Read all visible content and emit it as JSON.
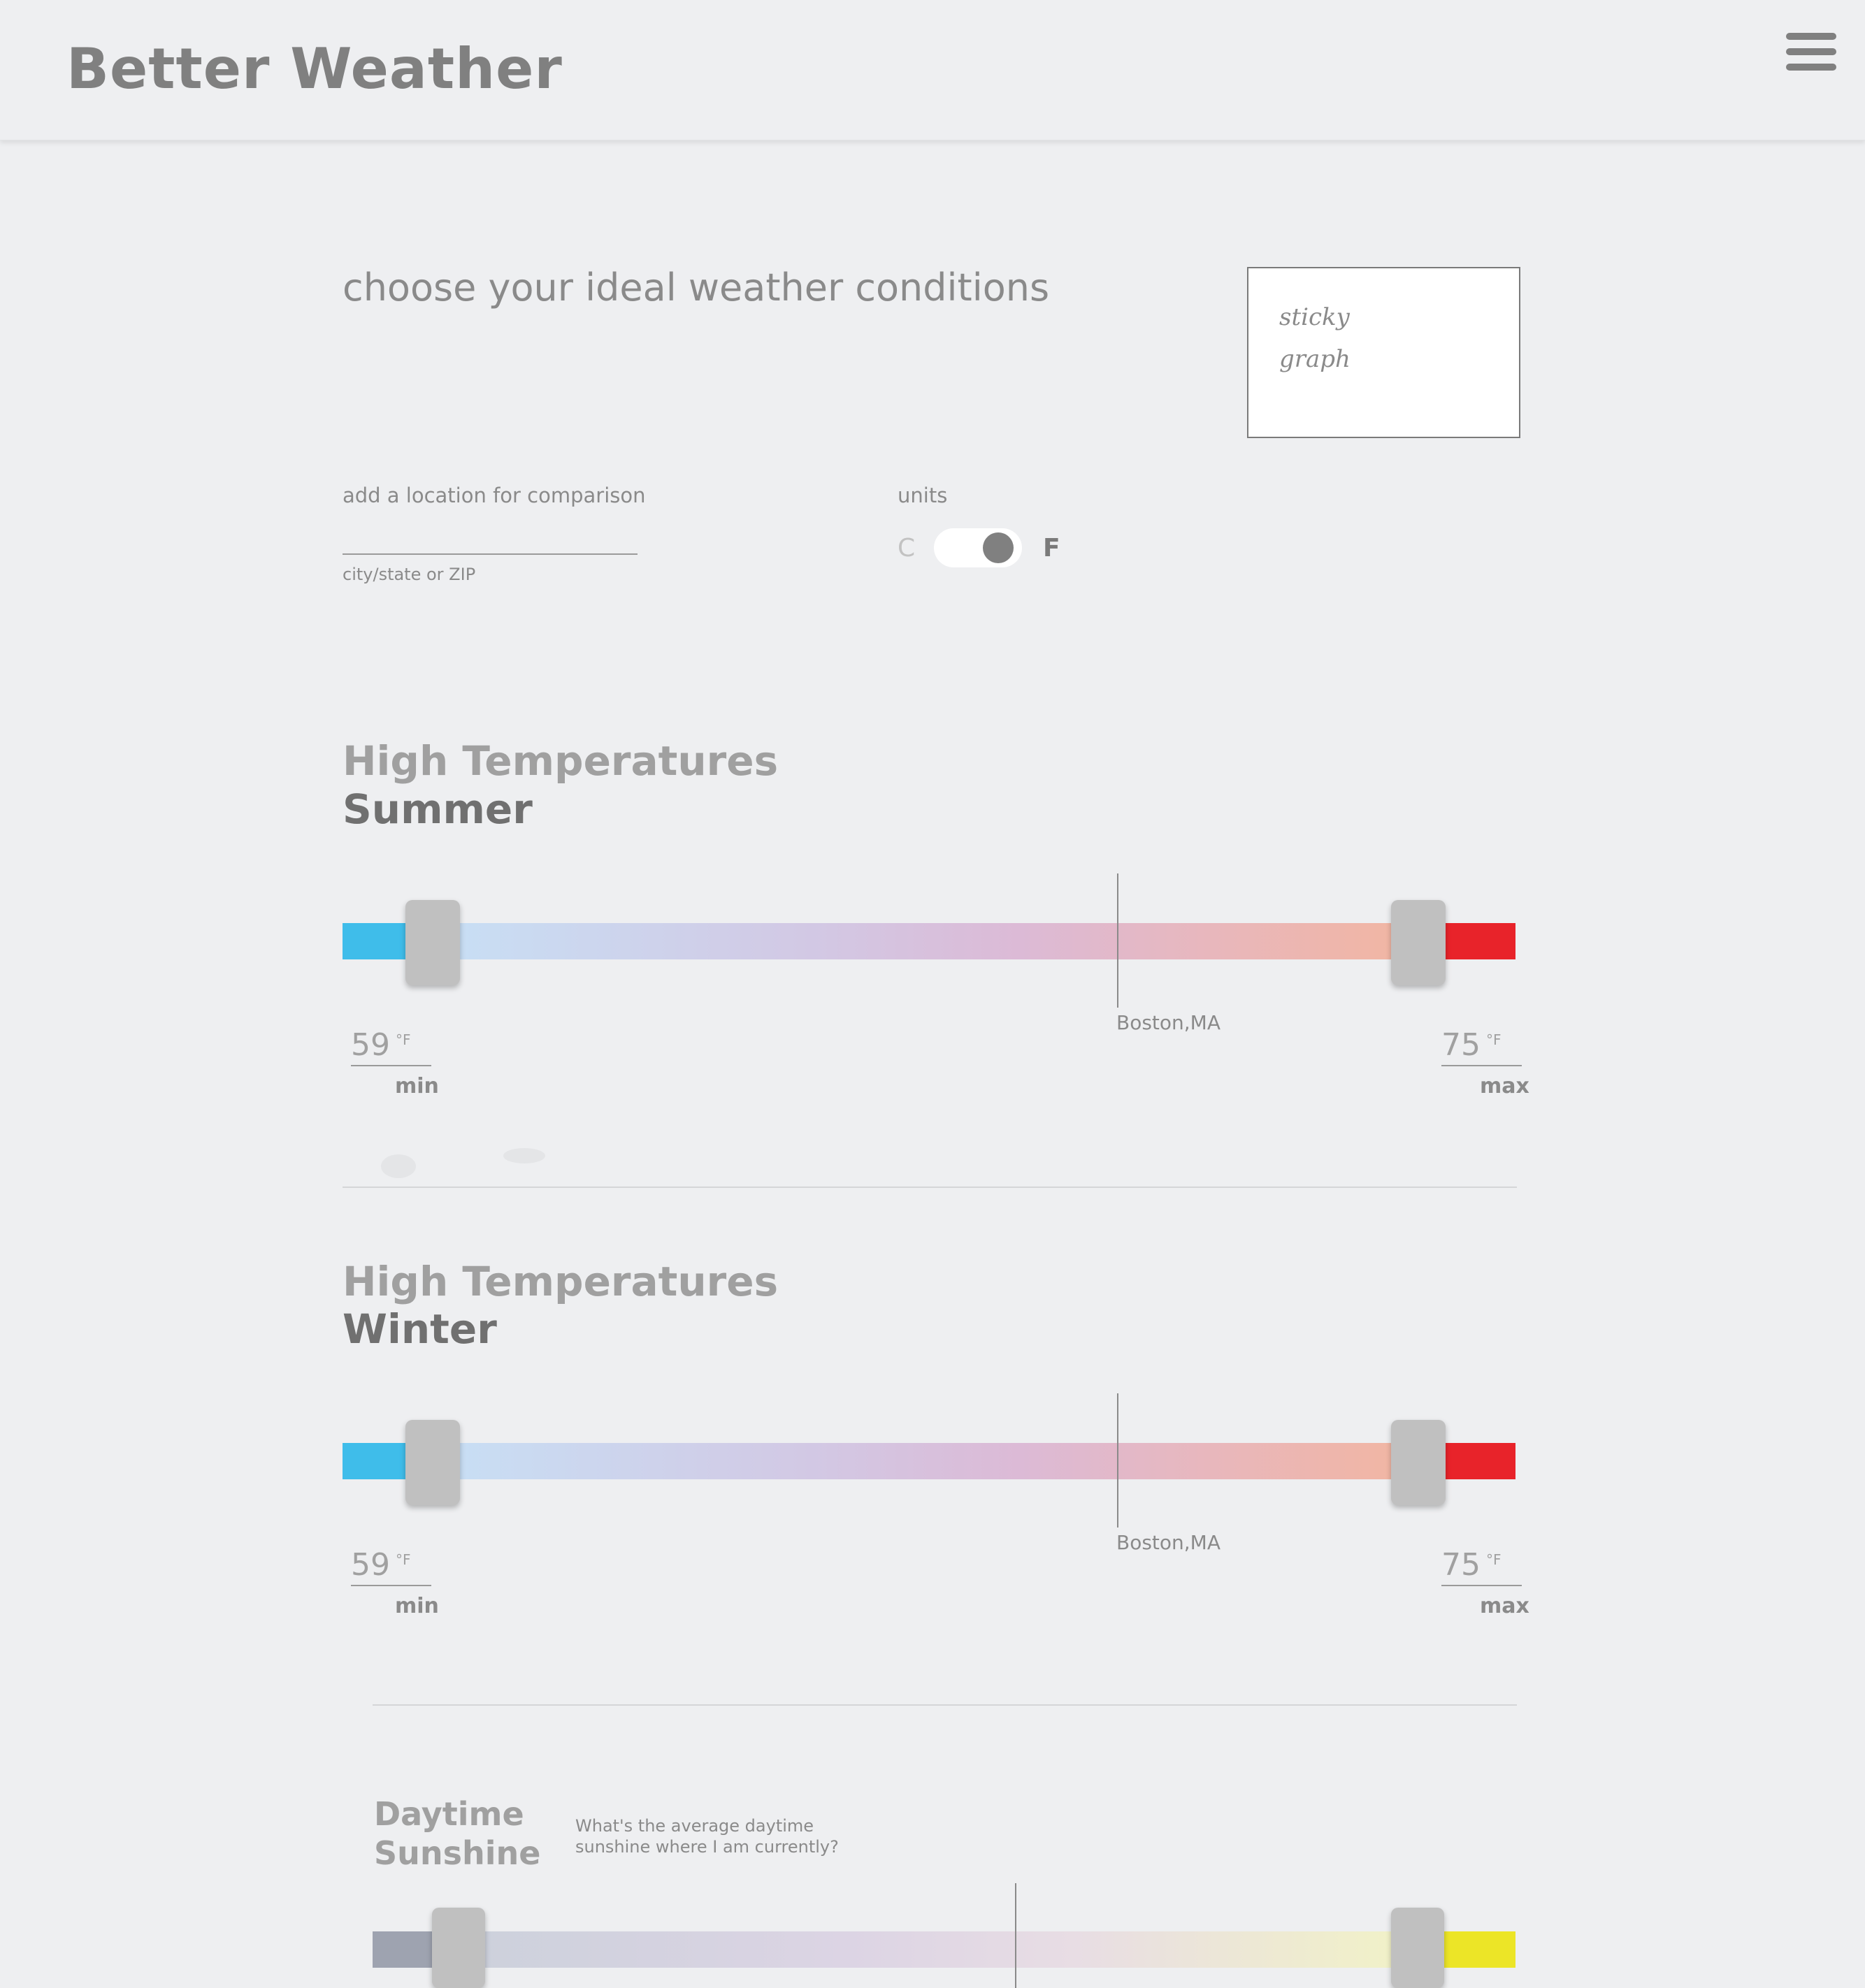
{
  "app": {
    "title": "Better Weather"
  },
  "intro": {
    "prompt": "choose your ideal weather conditions",
    "sticky_graph": {
      "line1": "sticky",
      "line2": "graph"
    }
  },
  "location": {
    "label": "add a location for comparison",
    "value": "",
    "placeholder": "",
    "hint": "city/state or ZIP"
  },
  "units": {
    "label": "units",
    "c": "C",
    "f": "F",
    "selected": "F"
  },
  "sections": [
    {
      "title": "High Temperatures",
      "subtitle": "Summer",
      "min": {
        "value": "59",
        "unit": "°F",
        "caption": "min"
      },
      "max": {
        "value": "75",
        "unit": "°F",
        "caption": "max"
      },
      "marker_label": "Boston,MA"
    },
    {
      "title": "High Temperatures",
      "subtitle": "Winter",
      "min": {
        "value": "59",
        "unit": "°F",
        "caption": "min"
      },
      "max": {
        "value": "75",
        "unit": "°F",
        "caption": "max"
      },
      "marker_label": "Boston,MA"
    },
    {
      "title_line1": "Daytime",
      "title_line2": "Sunshine",
      "question": "What's the average daytime sunshine where I am currently?"
    }
  ],
  "colors": {
    "cold": "#3fbdea",
    "hot": "#e8232a",
    "cloudy": "#9ea3b0",
    "sunny": "#ece527",
    "thumb": "#c0c0c0"
  },
  "icons": {
    "menu": "hamburger-menu-icon"
  }
}
